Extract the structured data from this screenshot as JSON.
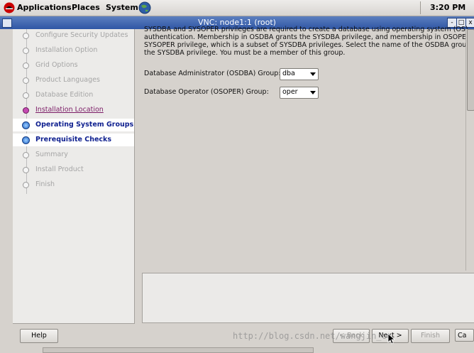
{
  "panel": {
    "menus": [
      "Applications",
      "Places",
      "System"
    ],
    "clock": "3:20 PM"
  },
  "window": {
    "title": "VNC: node1:1 (root)",
    "buttons": [
      "-",
      "□",
      "x"
    ]
  },
  "steps": [
    {
      "label": "Configure Security Updates",
      "state": "done"
    },
    {
      "label": "Installation Option",
      "state": "done"
    },
    {
      "label": "Grid Options",
      "state": "done"
    },
    {
      "label": "Product Languages",
      "state": "done"
    },
    {
      "label": "Database Edition",
      "state": "done"
    },
    {
      "label": "Installation Location",
      "state": "current"
    },
    {
      "label": "Operating System Groups",
      "state": "active"
    },
    {
      "label": "Prerequisite Checks",
      "state": "active"
    },
    {
      "label": "Summary",
      "state": "pending"
    },
    {
      "label": "Install Product",
      "state": "pending"
    },
    {
      "label": "Finish",
      "state": "pending"
    }
  ],
  "main": {
    "description": "SYSDBA and SYSOPER privileges are required to create a database using operating system (OS)\nauthentication. Membership in OSDBA grants the SYSDBA privilege, and membership in OSOPER grant\nSYSOPER privilege, which is a subset of SYSDBA privileges. Select the name of the OSDBA group to gra\nthe SYSDBA privilege. You must be a member of this group.",
    "osdba_label": "Database Administrator (OSDBA) Group:",
    "osdba_value": "dba",
    "osoper_label": "Database Operator (OSOPER) Group:",
    "osoper_value": "oper"
  },
  "buttons": {
    "help": "Help",
    "back": "< Back",
    "next": "Next >",
    "finish": "Finish",
    "cancel": "Ca"
  },
  "watermark": "http://blog.csdn.net/wangjin_co",
  "colors": {
    "active_step": "#0e1f8f",
    "current_step": "#7b1b66",
    "titlebar": "#3a63b0"
  }
}
